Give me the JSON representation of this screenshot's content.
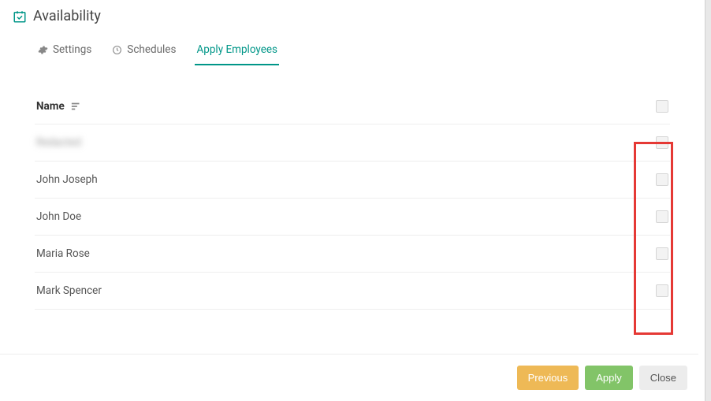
{
  "header": {
    "title": "Availability"
  },
  "tabs": {
    "settings": "Settings",
    "schedules": "Schedules",
    "apply_employees": "Apply Employees"
  },
  "table": {
    "header_name": "Name",
    "rows": [
      {
        "name": "Redacted"
      },
      {
        "name": "John Joseph"
      },
      {
        "name": "John Doe"
      },
      {
        "name": "Maria Rose"
      },
      {
        "name": "Mark Spencer"
      }
    ]
  },
  "footer": {
    "previous": "Previous",
    "apply": "Apply",
    "close": "Close"
  }
}
